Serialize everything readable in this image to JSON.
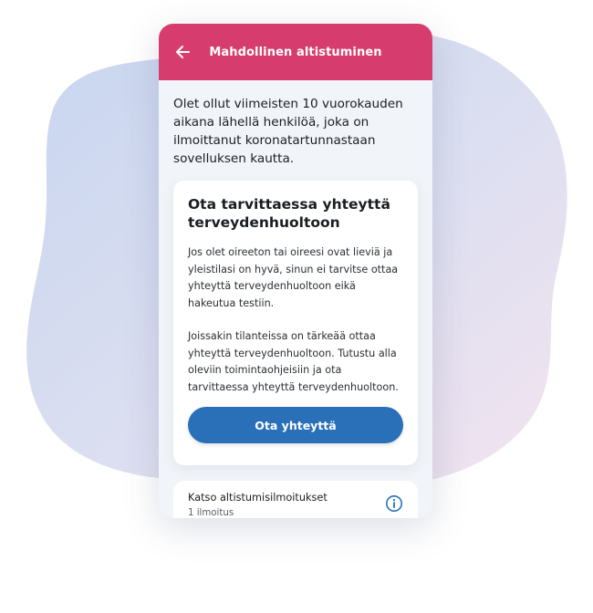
{
  "header": {
    "title": "Mahdollinen altistuminen",
    "back_icon": "arrow-left-icon"
  },
  "intro_text": "Olet ollut viimeisten 10 vuorokauden aikana lähellä henkilöä, joka on ilmoittanut koronatartunnastaan sovelluksen kautta.",
  "card": {
    "title": "Ota tarvittaessa yhteyttä terveydenhuoltoon",
    "paragraph1": "Jos olet oireeton tai oireesi ovat lieviä ja yleistilasi on hyvä, sinun ei tarvitse ottaa yhteyttä terveydenhuoltoon eikä hakeutua testiin.",
    "paragraph2": "Joissakin tilanteissa on tärkeää ottaa yhteyttä terveydenhuoltoon. Tutustu alla oleviin toimintaohjeisiin ja ota tarvittaessa yhteyttä terveydenhuoltoon.",
    "button_label": "Ota yhteyttä"
  },
  "exposures": {
    "title": "Katso altistumisilmoitukset",
    "count": "1 ilmoitus",
    "icon": "info-icon"
  },
  "colors": {
    "header": "#d63d6e",
    "button": "#2a70b8",
    "screen_background": "#f1f4f8",
    "info_icon": "#2a70b8"
  }
}
